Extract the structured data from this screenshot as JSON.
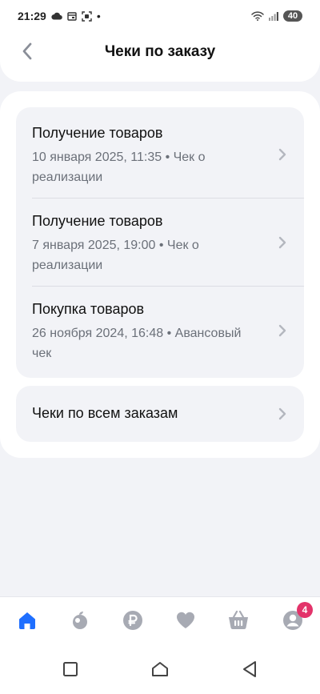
{
  "status_bar": {
    "time": "21:29",
    "dot": "•",
    "battery": "40",
    "icons": [
      "cloud-icon",
      "calendar-icon",
      "screenshot-icon",
      "wifi-icon",
      "signal-icon"
    ]
  },
  "header": {
    "title": "Чеки по заказу",
    "back_icon": "chevron-left-icon"
  },
  "receipts": [
    {
      "title": "Получение товаров",
      "subtitle": "10 января 2025, 11:35 • Чек о реализации"
    },
    {
      "title": "Получение товаров",
      "subtitle": "7 января 2025, 19:00 • Чек о реализации"
    },
    {
      "title": "Покупка товаров",
      "subtitle": "26 ноября 2024, 16:48 • Авансовый чек"
    }
  ],
  "all_orders": {
    "label": "Чеки по всем заказам"
  },
  "bottom_nav": {
    "items": [
      "home-icon",
      "catalog-icon",
      "payments-icon",
      "favorites-icon",
      "cart-icon",
      "profile-icon"
    ],
    "profile_badge": "4",
    "active_color": "#1f6fff",
    "inactive_color": "#a7aab3",
    "badge_color": "#e3336a"
  },
  "system_nav": [
    "recents-icon",
    "home-system-icon",
    "back-system-icon"
  ]
}
